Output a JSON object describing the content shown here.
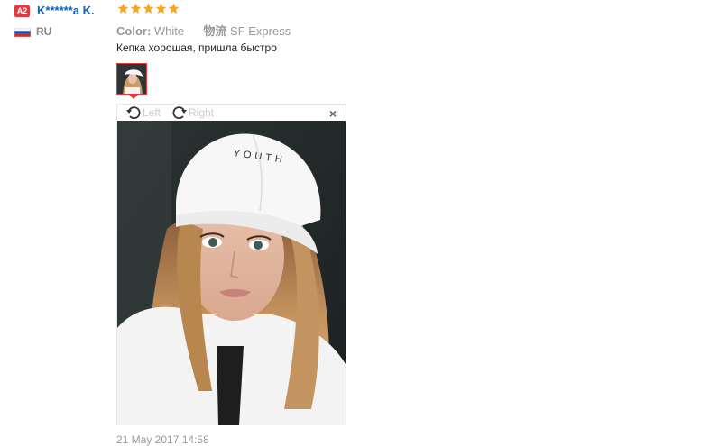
{
  "review": {
    "badge": "A2",
    "username": "K******a K.",
    "rating": 5,
    "country": "RU",
    "color_label": "Color:",
    "color_value": "White",
    "shipping_label": "物流",
    "shipping_value": "SF Express",
    "text": "Кепка хорошая, пришла быстро",
    "date": "21 May 2017 14:58"
  },
  "viewer": {
    "rotate_left": "Left",
    "rotate_right": "Right",
    "close": "×",
    "cap_text": "YOUTH"
  },
  "colors": {
    "star": "#f5a623",
    "username": "#0b62bf",
    "badge": "#e4393c"
  }
}
